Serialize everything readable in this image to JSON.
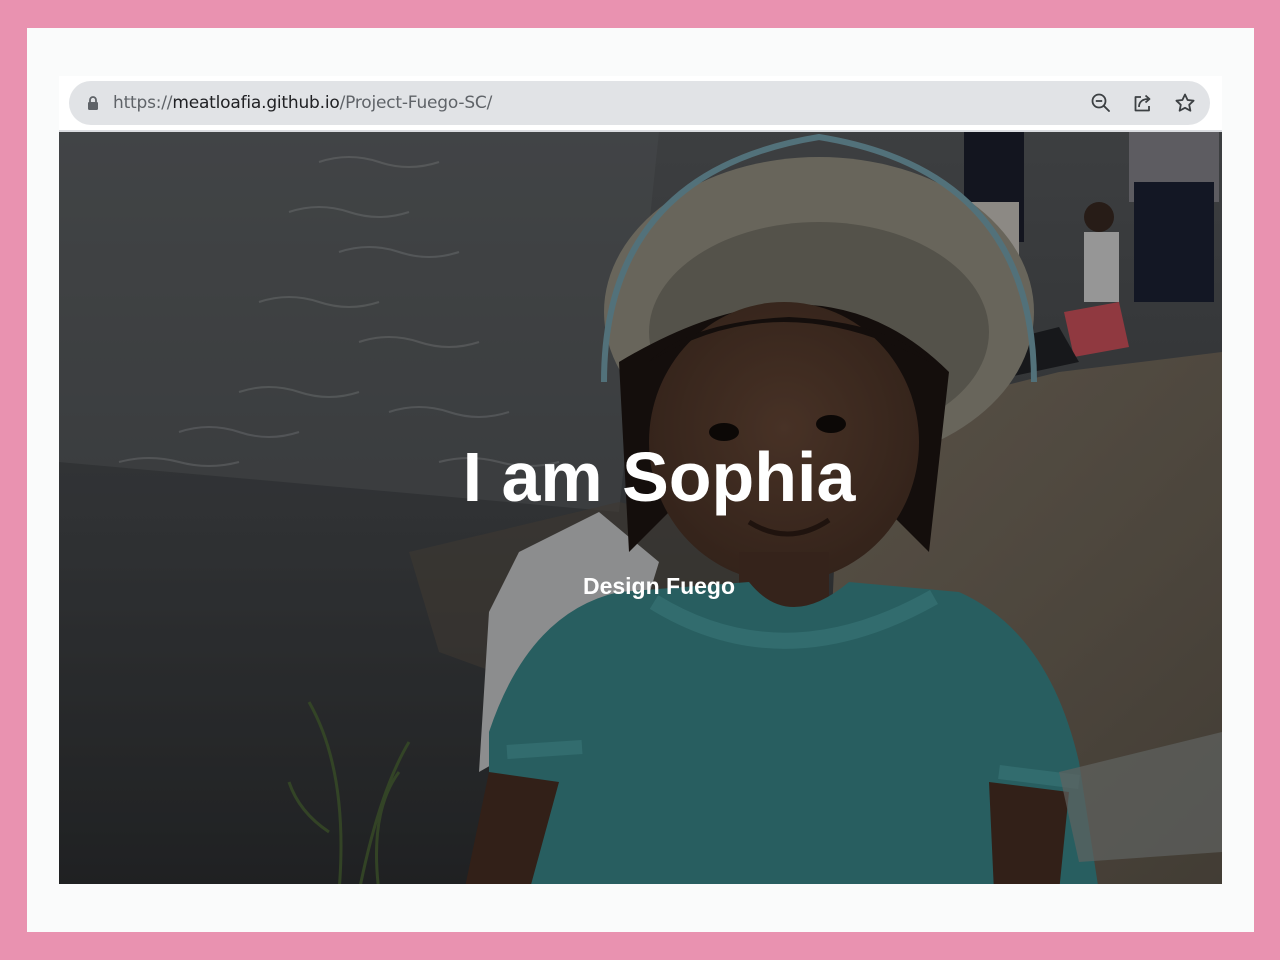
{
  "browser": {
    "url_prefix": "https://",
    "url_host": "meatloafia.github.io",
    "url_path": "/Project-Fuego-SC/",
    "icons": [
      "lock-icon",
      "zoom-out-icon",
      "share-icon",
      "bookmark-star-icon"
    ]
  },
  "hero": {
    "title": "I am Sophia",
    "subtitle": "Design Fuego"
  },
  "colors": {
    "page_border": "#e992b0",
    "omnibox": "#e1e3e6",
    "hero_text": "#ffffff"
  }
}
